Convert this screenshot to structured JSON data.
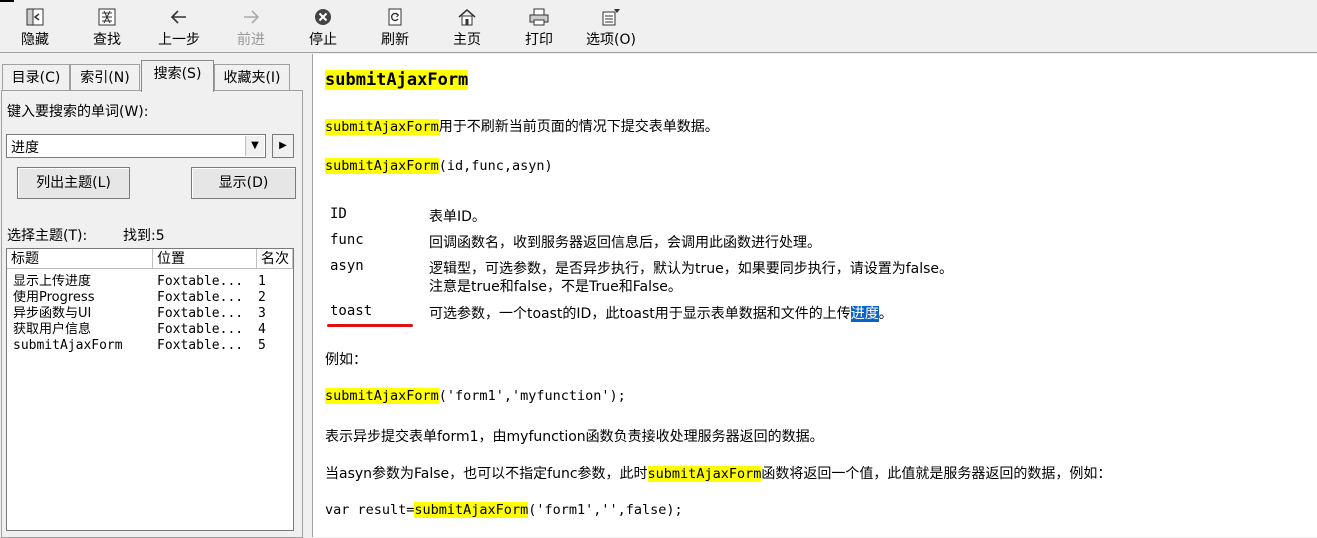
{
  "toolbar": {
    "buttons": [
      {
        "label": "隐藏",
        "icon": "hide-icon"
      },
      {
        "label": "查找",
        "icon": "locate-icon"
      },
      {
        "label": "上一步",
        "icon": "back-arrow-icon"
      },
      {
        "label": "前进",
        "icon": "forward-arrow-icon"
      },
      {
        "label": "停止",
        "icon": "stop-icon"
      },
      {
        "label": "刷新",
        "icon": "refresh-icon"
      },
      {
        "label": "主页",
        "icon": "home-icon"
      },
      {
        "label": "打印",
        "icon": "printer-icon"
      },
      {
        "label": "选项(O)",
        "icon": "options-icon"
      }
    ]
  },
  "tabs": [
    "目录(C)",
    "索引(N)",
    "搜索(S)",
    "收藏夹(I)"
  ],
  "search": {
    "prompt": "键入要搜索的单词(W):",
    "value": "进度",
    "list_topics_label": "列出主题(L)",
    "display_label": "显示(D)",
    "select_topic_label": "选择主题(T):",
    "found_label": "找到:5"
  },
  "results": {
    "columns": [
      "标题",
      "位置",
      "名次"
    ],
    "rows": [
      {
        "title": "显示上传进度",
        "location": "Foxtable...",
        "rank": "1"
      },
      {
        "title": "使用Progress",
        "location": "Foxtable...",
        "rank": "2"
      },
      {
        "title": "异步函数与UI",
        "location": "Foxtable...",
        "rank": "3"
      },
      {
        "title": "获取用户信息",
        "location": "Foxtable...",
        "rank": "4"
      },
      {
        "title": "submitAjaxForm",
        "location": "Foxtable...",
        "rank": "5"
      }
    ]
  },
  "content": {
    "title": "submitAjaxForm",
    "func": "submitAjaxForm",
    "desc_suffix": "用于不刷新当前页面的情况下提交表单数据。",
    "signature_suffix": "(id,func,asyn)",
    "params": [
      {
        "name": "ID",
        "desc": "表单ID。"
      },
      {
        "name": "func",
        "desc": "回调函数名，收到服务器返回信息后，会调用此函数进行处理。"
      },
      {
        "name": "asyn",
        "desc": "逻辑型，可选参数，是否异步执行，默认为true，如果要同步执行，请设置为false。",
        "desc2": "注意是true和false，不是True和False。"
      },
      {
        "name": "toast",
        "desc": "可选参数，一个toast的ID，此toast用于显示表单数据和文件的上传",
        "desc_selected": "进度",
        "desc_end": "。"
      }
    ],
    "example_label": "例如：",
    "example_code_suffix": "('form1','myfunction');",
    "example_desc": "表示异步提交表单form1，由myfunction函数负责接收处理服务器返回的数据。",
    "sync_prefix": "当asyn参数为False，也可以不指定func参数，此时",
    "sync_suffix": "函数将返回一个值，此值就是服务器返回的数据，例如：",
    "var_prefix": "var result=",
    "var_suffix": "('form1','',false);"
  },
  "colors": {
    "highlight": "#ffff00",
    "selection": "#0a64c8",
    "annotation": "#e01010"
  }
}
